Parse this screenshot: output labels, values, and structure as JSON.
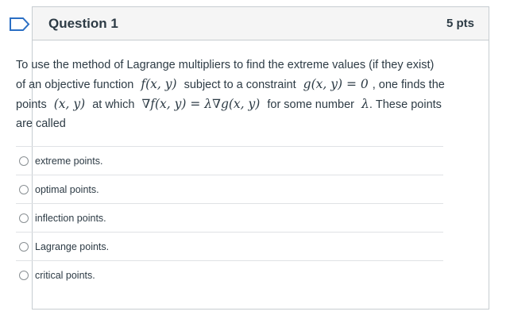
{
  "question": {
    "title": "Question 1",
    "points": "5 pts",
    "text": {
      "p1": "To use the method of Lagrange multipliers to find the extreme values (if they exist) of an objective function",
      "m1": "f(x, y)",
      "p2": "subject to a constraint",
      "m2": "g(x, y) = 0",
      "p3": ", one finds the points",
      "m3": "(x, y)",
      "p4": "at which",
      "m4": "∇f(x, y) = λ∇g(x, y)",
      "p5": "for some number",
      "m5": "λ",
      "p6": ". These points are called"
    }
  },
  "answers": [
    {
      "label": "extreme points."
    },
    {
      "label": "optimal points."
    },
    {
      "label": "inflection points."
    },
    {
      "label": "Lagrange points."
    },
    {
      "label": "critical points."
    }
  ],
  "colors": {
    "accent": "#2b6fc4",
    "header_bg": "#f5f5f5",
    "border": "#c7cdd1",
    "text": "#2d3b45"
  }
}
